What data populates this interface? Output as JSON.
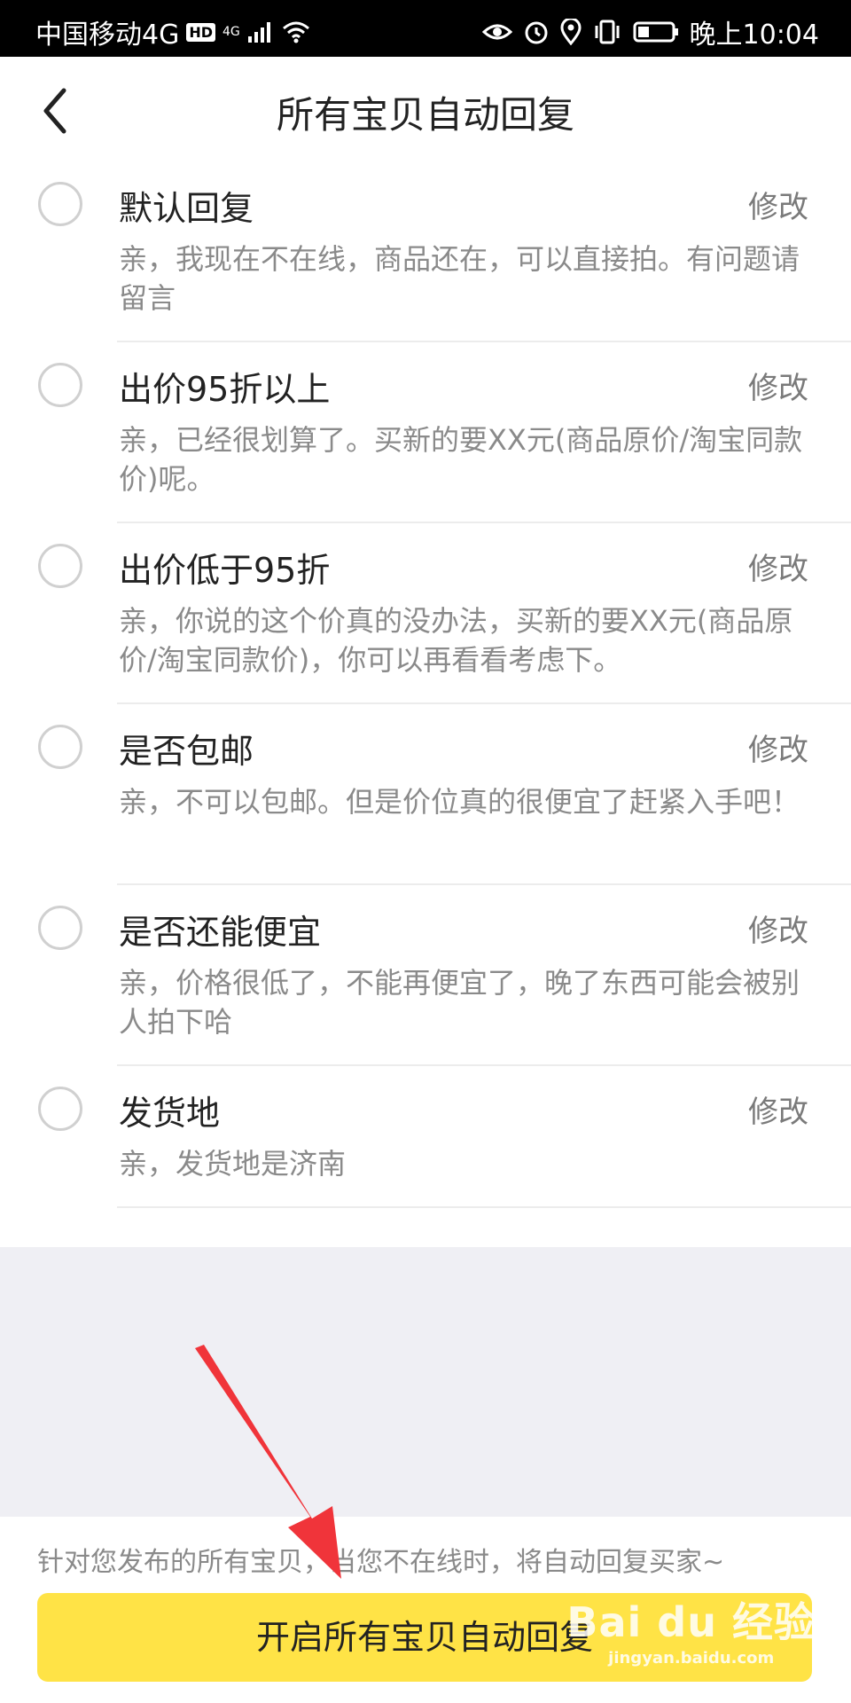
{
  "status_bar": {
    "carrier": "中国移动4G",
    "hd": "HD",
    "network": "4G",
    "time": "晚上10:04",
    "icons": [
      "signal-icon",
      "wifi-icon",
      "eye-icon",
      "alarm-icon",
      "location-icon",
      "vibrate-icon",
      "battery-icon"
    ]
  },
  "header": {
    "title": "所有宝贝自动回复",
    "back_icon": "chevron-left-icon"
  },
  "replies": [
    {
      "title": "默认回复",
      "edit_label": "修改",
      "message": "亲，我现在不在线，商品还在，可以直接拍。有问题请留言"
    },
    {
      "title": "出价95折以上",
      "edit_label": "修改",
      "message": "亲，已经很划算了。买新的要XX元(商品原价/淘宝同款价)呢。"
    },
    {
      "title": "出价低于95折",
      "edit_label": "修改",
      "message": "亲，你说的这个价真的没办法，买新的要XX元(商品原价/淘宝同款价)，你可以再看看考虑下。"
    },
    {
      "title": "是否包邮",
      "edit_label": "修改",
      "message": "亲，不可以包邮。但是价位真的很便宜了赶紧入手吧！"
    },
    {
      "title": "是否还能便宜",
      "edit_label": "修改",
      "message": "亲，价格很低了，不能再便宜了，晚了东西可能会被别人拍下哈"
    },
    {
      "title": "发货地",
      "edit_label": "修改",
      "message": "亲，发货地是济南"
    }
  ],
  "footer": {
    "note": "针对您发布的所有宝贝，当您不在线时，将自动回复买家~",
    "button_label": "开启所有宝贝自动回复"
  },
  "watermark": {
    "main": "Bai du 经验",
    "sub": "jingyan.baidu.com"
  },
  "colors": {
    "accent_yellow": "#ffe346",
    "annotation_red": "#f0343a",
    "background_gray": "#efeff4"
  }
}
